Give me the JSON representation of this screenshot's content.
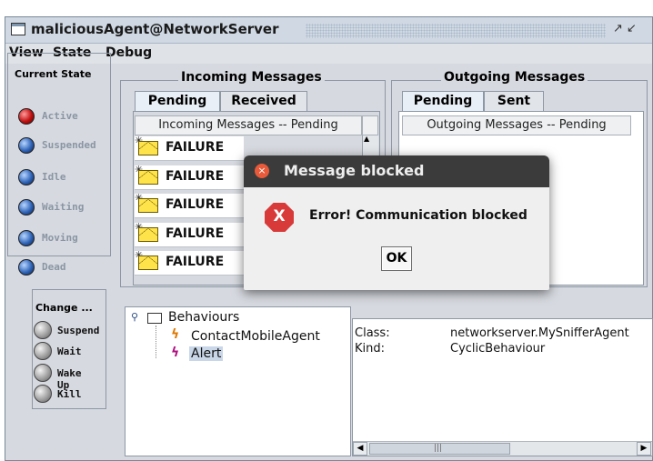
{
  "window": {
    "title": "maliciousAgent@NetworkServer",
    "controls": "↗↙"
  },
  "menu": [
    "View",
    "State",
    "Debug"
  ],
  "current_state": {
    "title": "Current State",
    "items": [
      {
        "label": "Active",
        "color": "#c01010"
      },
      {
        "label": "Suspended",
        "color": "#2f64b8"
      },
      {
        "label": "Idle",
        "color": "#2f64b8"
      },
      {
        "label": "Waiting",
        "color": "#2f64b8"
      },
      {
        "label": "Moving",
        "color": "#2f64b8"
      },
      {
        "label": "Dead",
        "color": "#2f64b8"
      }
    ]
  },
  "change": {
    "title": "Change ...",
    "items": [
      "Suspend",
      "Wait",
      "Wake Up",
      "Kill"
    ]
  },
  "incoming": {
    "title": "Incoming Messages",
    "tabs": [
      "Pending",
      "Received"
    ],
    "header": "Incoming Messages -- Pending",
    "messages": [
      "FAILURE",
      "FAILURE",
      "FAILURE",
      "FAILURE",
      "FAILURE"
    ]
  },
  "outgoing": {
    "title": "Outgoing Messages",
    "tabs": [
      "Pending",
      "Sent"
    ],
    "header": "Outgoing Messages -- Pending"
  },
  "tree": {
    "root": "Behaviours",
    "children": [
      "ContactMobileAgent",
      "Alert"
    ],
    "selected": "Alert"
  },
  "properties": {
    "class_label": "Class:",
    "class_value": "networkserver.MySnifferAgent",
    "kind_label": "Kind:",
    "kind_value": "CyclicBehaviour"
  },
  "scrollbar": {
    "grip": "|||"
  },
  "dialog": {
    "title": "Message blocked",
    "icon_text": "X",
    "message": "Error! Communication blocked",
    "ok": "OK"
  }
}
